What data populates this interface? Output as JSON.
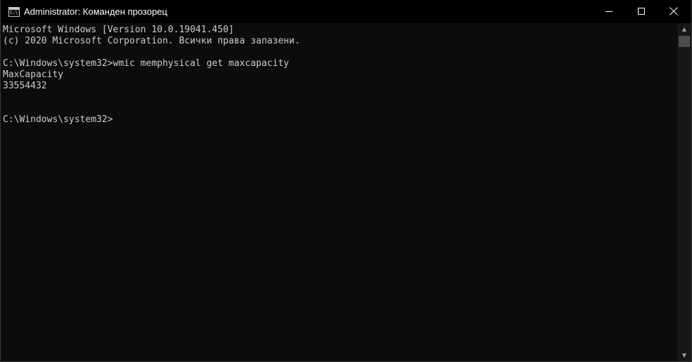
{
  "window": {
    "title": "Administrator: Команден прозорец",
    "icon_text": "C:\\."
  },
  "console": {
    "lines": [
      "Microsoft Windows [Version 10.0.19041.450]",
      "(c) 2020 Microsoft Corporation. Всички права запазени.",
      "",
      "C:\\Windows\\system32>wmic memphysical get maxcapacity",
      "MaxCapacity",
      "33554432",
      "",
      "",
      "C:\\Windows\\system32>"
    ]
  },
  "scrollbar": {
    "up_glyph": "▲",
    "down_glyph": "▼"
  },
  "colors": {
    "console_bg": "#0c0c0c",
    "console_fg": "#cccccc",
    "titlebar_bg": "#000000"
  }
}
